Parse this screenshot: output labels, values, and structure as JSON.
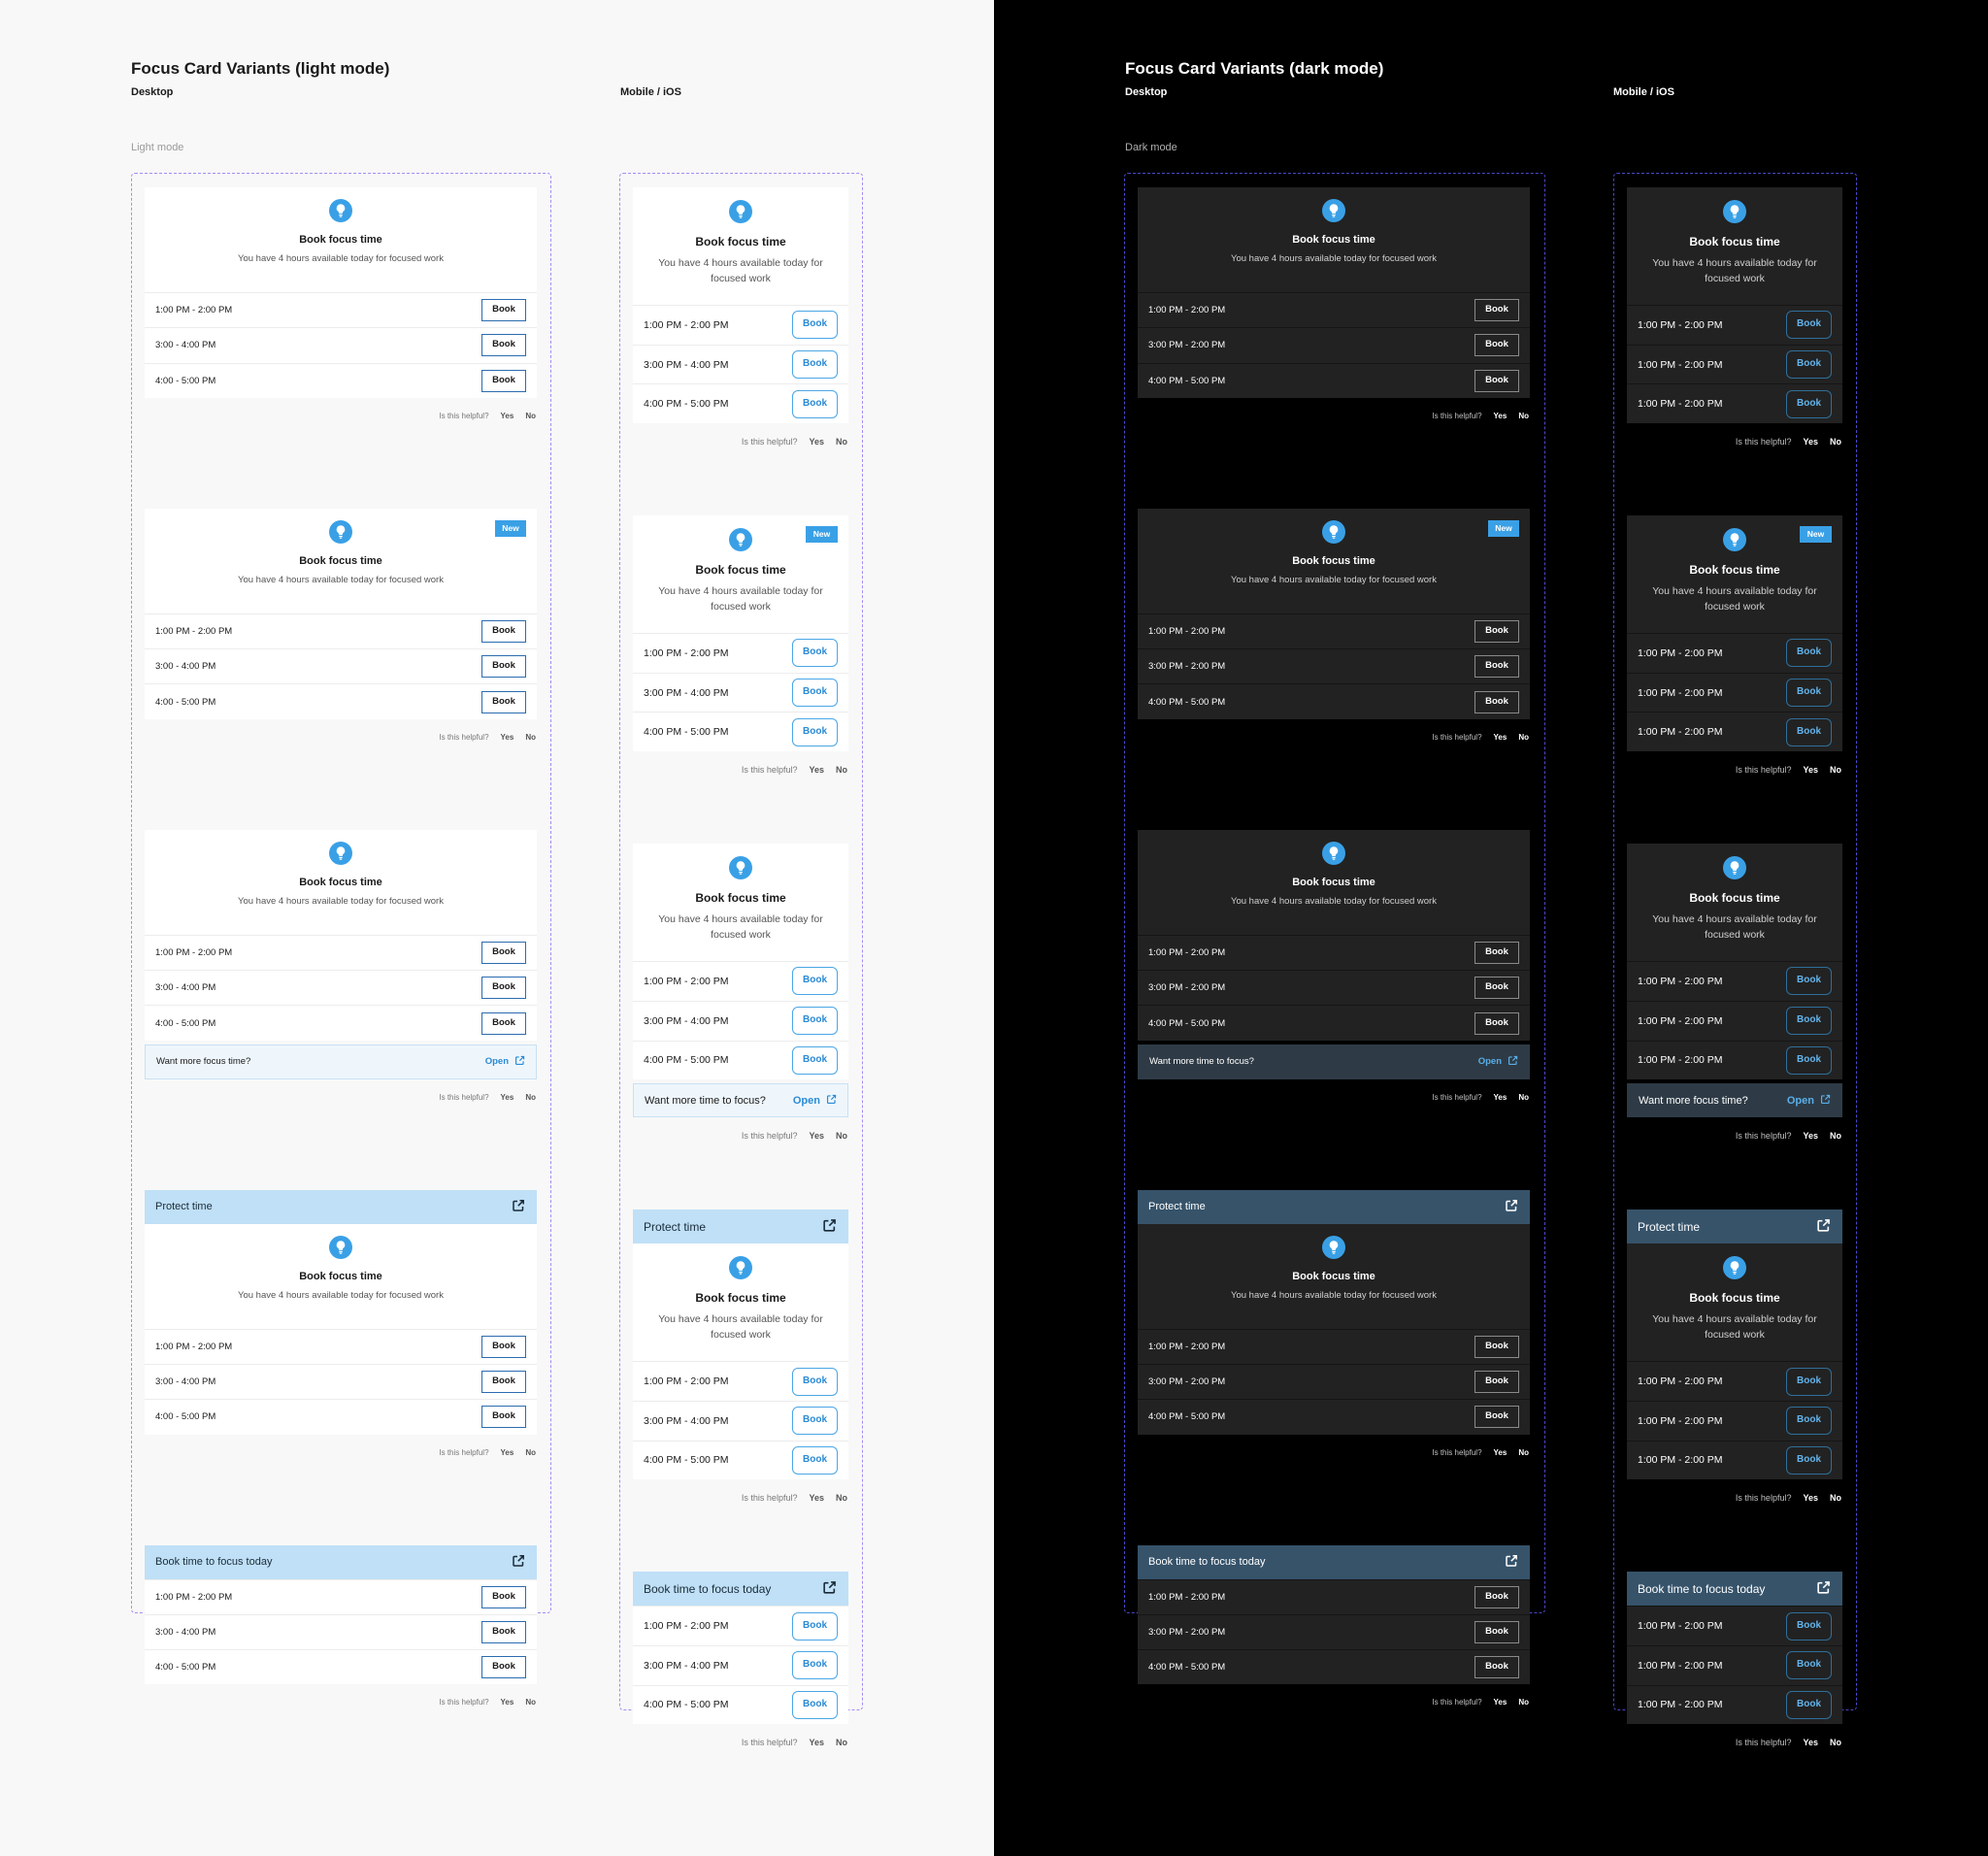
{
  "light": {
    "title": "Focus Card Variants (light mode)",
    "desktop_label": "Desktop",
    "mobile_label": "Mobile / iOS",
    "mode_label": "Light mode"
  },
  "dark": {
    "title": "Focus Card Variants (dark mode)",
    "desktop_label": "Desktop",
    "mobile_label": "Mobile / iOS",
    "mode_label": "Dark mode"
  },
  "card": {
    "title": "Book focus time",
    "description": "You have 4 hours available today for focused work",
    "book_label": "Book",
    "new_badge": "New",
    "protect_header": "Protect time",
    "book_today_header": "Book time to focus today",
    "open_label": "Open",
    "feedback_question": "Is this helpful?",
    "feedback_yes": "Yes",
    "feedback_no": "No",
    "bulb_icon": "lightbulb-icon",
    "external_icon": "external-link-icon"
  },
  "slots": {
    "desktop": [
      "1:00 PM - 2:00 PM",
      "3:00 - 4:00 PM",
      "4:00 - 5:00 PM"
    ],
    "mobile": [
      "1:00 PM - 2:00 PM",
      "3:00 PM - 4:00 PM",
      "4:00 PM - 5:00 PM"
    ],
    "dark_desktop": [
      "1:00 PM - 2:00 PM",
      "3:00 PM - 2:00 PM",
      "4:00 PM - 5:00 PM"
    ],
    "dark_mobile": [
      "1:00 PM - 2:00 PM",
      "1:00 PM - 2:00 PM",
      "1:00 PM - 2:00 PM"
    ]
  },
  "promo": {
    "light_desktop": "Want more focus time?",
    "light_mobile": "Want more time to focus?",
    "dark_desktop": "Want more time to focus?",
    "dark_mobile": "Want more focus time?"
  },
  "colors": {
    "accent": "#3aa0e6",
    "header_light": "#bfe0f6",
    "header_dark": "#36536a",
    "frame_light": "#a48cf2",
    "frame_dark": "#4a48c8"
  }
}
